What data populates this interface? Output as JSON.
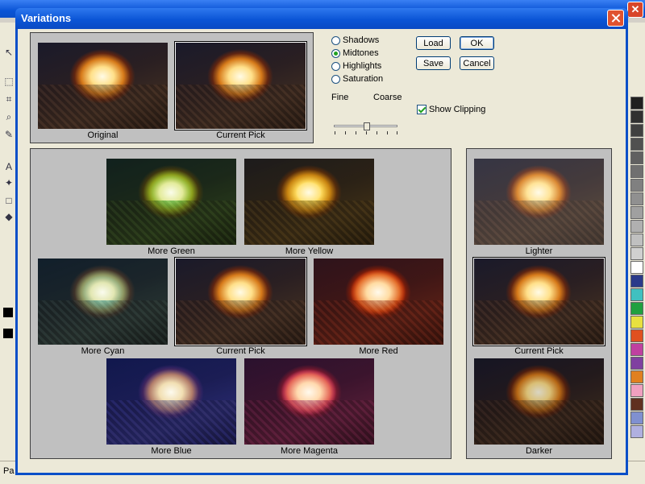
{
  "background": {
    "status_text": "Pa"
  },
  "dialog": {
    "title": "Variations",
    "top_thumbs": [
      {
        "label": "Original"
      },
      {
        "label": "Current Pick"
      }
    ],
    "tone_options": [
      {
        "label": "Shadows",
        "checked": false
      },
      {
        "label": "Midtones",
        "checked": true
      },
      {
        "label": "Highlights",
        "checked": false
      },
      {
        "label": "Saturation",
        "checked": false
      }
    ],
    "slider": {
      "fine_label": "Fine",
      "coarse_label": "Coarse",
      "level": 0.55
    },
    "buttons": {
      "load": "Load",
      "ok": "OK",
      "save": "Save",
      "cancel": "Cancel"
    },
    "show_clipping": {
      "label": "Show Clipping",
      "checked": true
    },
    "color_variations": [
      {
        "label": "More Green"
      },
      {
        "label": "More Yellow"
      },
      {
        "label": "More Cyan"
      },
      {
        "label": "Current Pick"
      },
      {
        "label": "More Red"
      },
      {
        "label": "More Blue"
      },
      {
        "label": "More Magenta"
      }
    ],
    "brightness_variations": [
      {
        "label": "Lighter"
      },
      {
        "label": "Current Pick"
      },
      {
        "label": "Darker"
      }
    ]
  },
  "palette_colors": [
    "#202020",
    "#303030",
    "#404040",
    "#505050",
    "#606060",
    "#707070",
    "#808080",
    "#909090",
    "#a0a0a0",
    "#b0b0b0",
    "#c0c0c0",
    "#d0d0d0",
    "#ffffff",
    "#2a3a8a",
    "#40c0c0",
    "#20a040",
    "#e8e040",
    "#e05020",
    "#c040a0",
    "#8040a0",
    "#e08020",
    "#f0a0c0",
    "#603020",
    "#8090d0",
    "#b0b0e0"
  ]
}
